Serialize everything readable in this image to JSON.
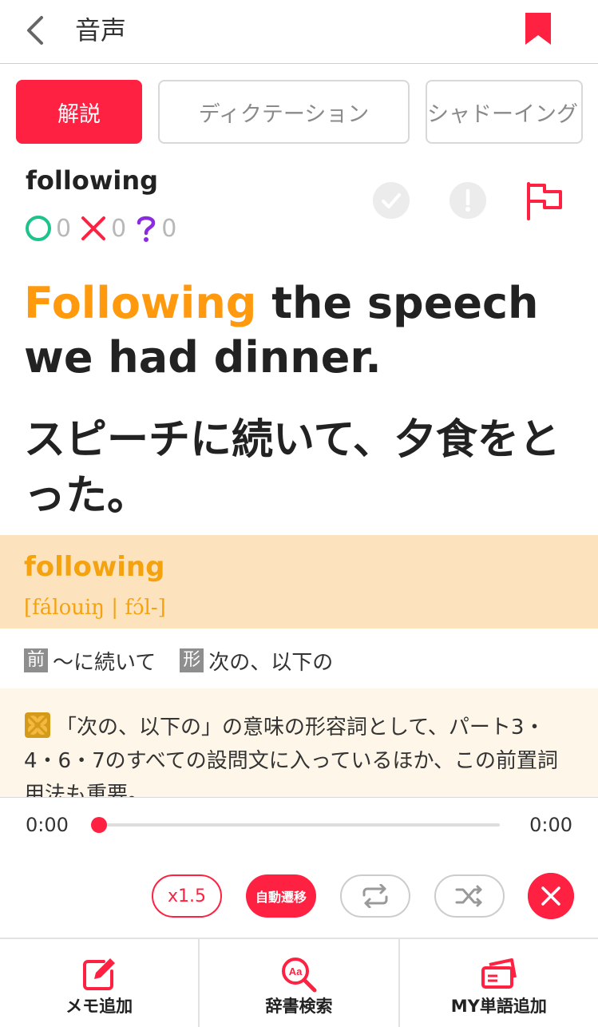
{
  "header": {
    "title": "音声"
  },
  "tabs": [
    {
      "label": "解説",
      "active": true
    },
    {
      "label": "ディクテーション",
      "active": false
    },
    {
      "label": "シャドーイング",
      "active": false
    }
  ],
  "word": {
    "title": "following",
    "stats": {
      "correct": "0",
      "wrong": "0",
      "unsure": "0"
    }
  },
  "sentence": {
    "highlight": "Following",
    "rest": " the speech we had dinner.",
    "japanese": "スピーチに続いて、夕食をとった。"
  },
  "entry": {
    "word": "following",
    "ipa": "[fálouiŋ | fɔ́l-]",
    "meanings": [
      {
        "pos": "前",
        "text": "〜に続いて"
      },
      {
        "pos": "形",
        "text": "次の、以下の"
      }
    ],
    "note": "「次の、以下の」の意味の形容詞として、パート3・4・6・7のすべての設問文に入っているほか、この前置詞用法も重要。"
  },
  "player": {
    "current_time": "0:00",
    "total_time": "0:00",
    "progress": 0,
    "speed_label": "x1.5",
    "auto_label": "自動遷移"
  },
  "bottom_nav": [
    {
      "label": "メモ追加",
      "icon": "memo-edit-icon"
    },
    {
      "label": "辞書検索",
      "icon": "dictionary-search-icon"
    },
    {
      "label": "MY単語追加",
      "icon": "wordcard-add-icon"
    }
  ],
  "colors": {
    "accent": "#ff2141",
    "highlight": "#ff9a0e",
    "entry_bg": "#fce3bd",
    "correct": "#1ec28b",
    "wrong": "#ff2141",
    "unsure": "#8a2be2"
  }
}
